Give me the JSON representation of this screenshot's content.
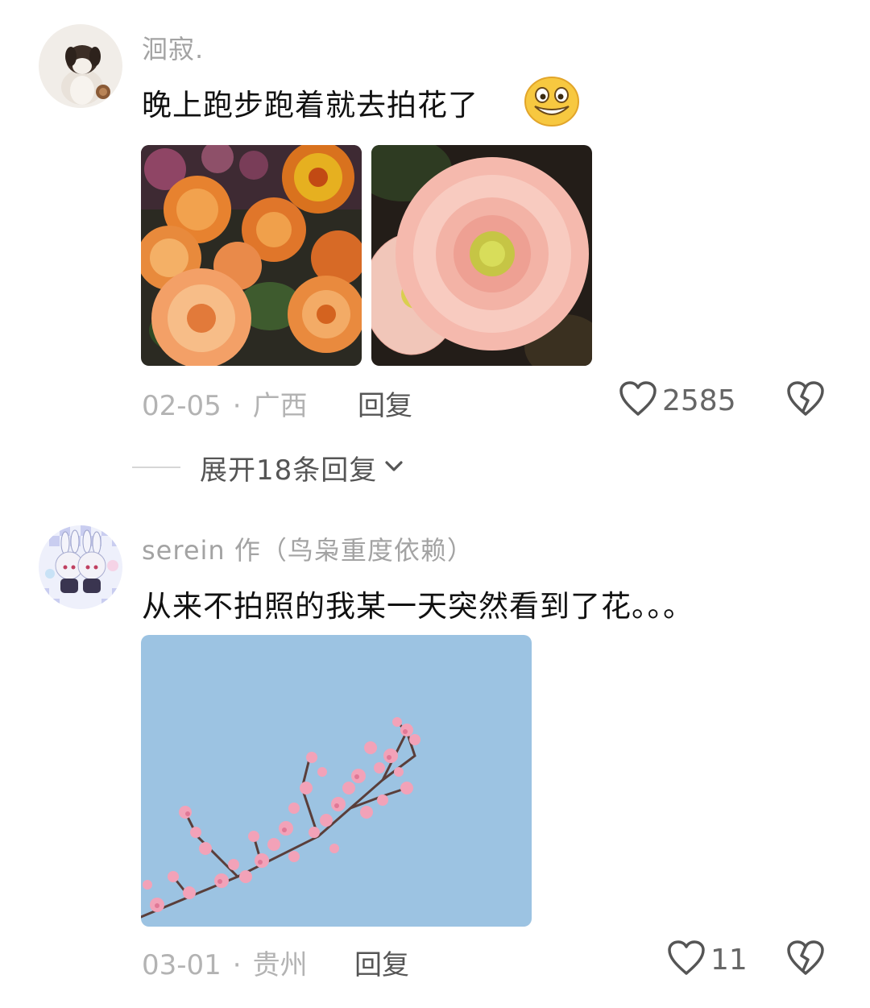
{
  "comments": [
    {
      "username": "洄寂.",
      "text": "晚上跑步跑着就去拍花了",
      "emoji": "grinning-face-emoji",
      "images": [
        "orange-dahlia-photo",
        "pink-gerbera-photo"
      ],
      "date": "02-05",
      "location": "广西",
      "reply_label": "回复",
      "likes": "2585",
      "expand_label": "展开18条回复"
    },
    {
      "username": "serein 作（鸟枭重度依赖）",
      "text": "从来不拍照的我某一天突然看到了花。。。",
      "images": [
        "plum-blossom-sky-photo"
      ],
      "date": "03-01",
      "location": "贵州",
      "reply_label": "回复",
      "likes": "11"
    }
  ],
  "separator": "·",
  "icons": {
    "like": "heart-outline-icon",
    "dislike": "broken-heart-icon",
    "expand": "chevron-down-icon"
  },
  "colors": {
    "username": "#a3a3a3",
    "meta": "#b3b3b3",
    "sky": "#9cc3e2",
    "blossom": "#f2a2b8"
  }
}
